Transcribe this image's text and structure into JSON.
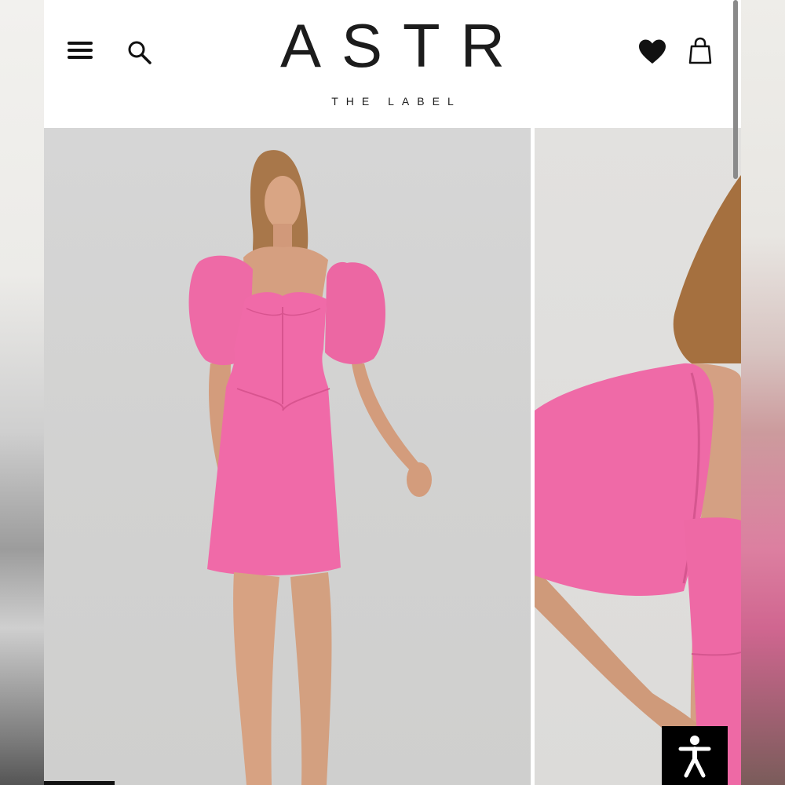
{
  "brand": {
    "logo_text": "ASTR",
    "tagline": "THE LABEL"
  },
  "header": {
    "icons": [
      "menu-icon",
      "search-icon",
      "heart-icon",
      "shopping-bag-icon"
    ]
  },
  "product": {
    "dress_color": "#f06aa8",
    "images": [
      "front-view",
      "sleeve-detail"
    ]
  },
  "accessibility": {
    "icon": "accessibility-icon"
  }
}
